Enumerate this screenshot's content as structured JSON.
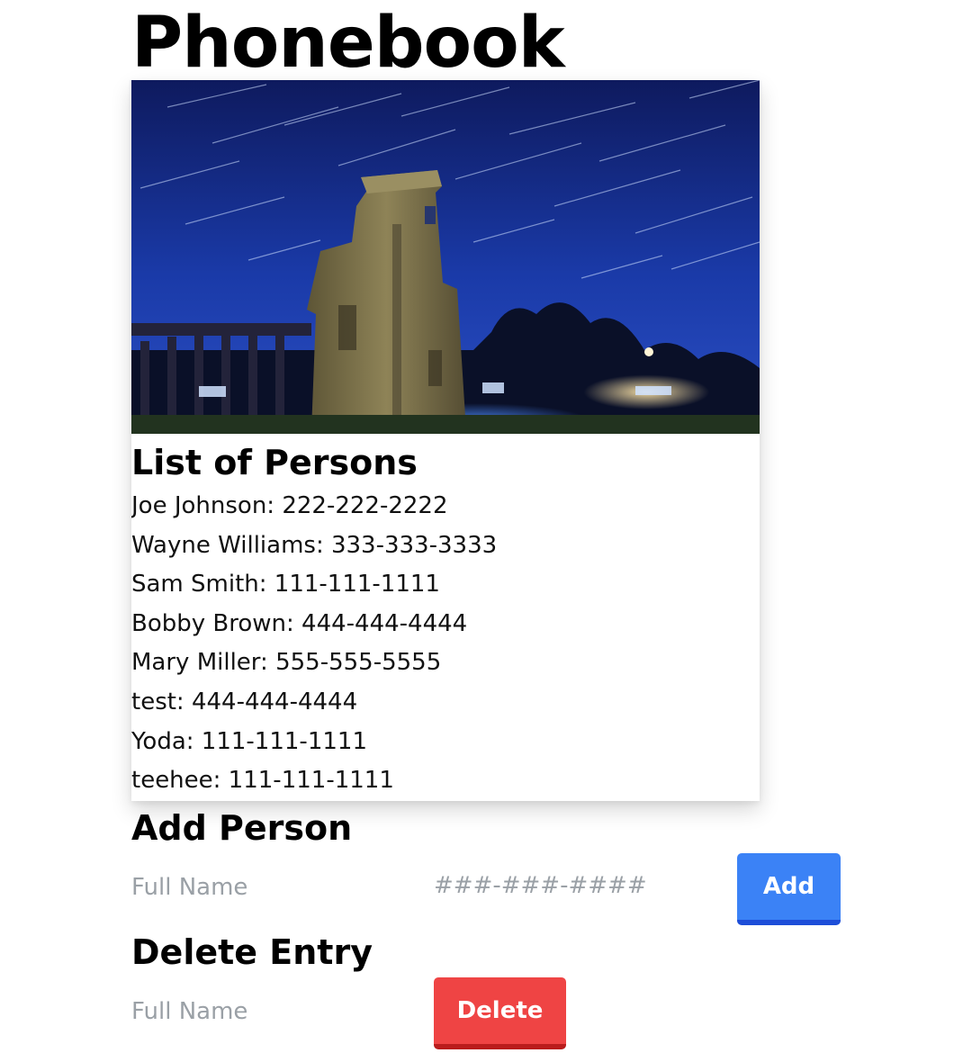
{
  "app": {
    "title": "Phonebook"
  },
  "list": {
    "heading": "List of Persons",
    "persons": [
      "Joe Johnson: 222-222-2222",
      "Wayne Williams: 333-333-3333",
      "Sam Smith: 111-111-1111",
      "Bobby Brown: 444-444-4444",
      "Mary Miller: 555-555-5555",
      "test: 444-444-4444",
      "Yoda: 111-111-1111",
      "teehee: 111-111-1111"
    ]
  },
  "add_form": {
    "heading": "Add Person",
    "name_placeholder": "Full Name",
    "name_value": "",
    "phone_placeholder": "###-###-####",
    "phone_value": "",
    "button_label": "Add",
    "button_color": "#3b82f6"
  },
  "delete_form": {
    "heading": "Delete Entry",
    "name_placeholder": "Full Name",
    "name_value": "",
    "button_label": "Delete",
    "button_color": "#ef4444"
  },
  "hero_image": {
    "icon": "night-ruins-star-trails-photo"
  }
}
